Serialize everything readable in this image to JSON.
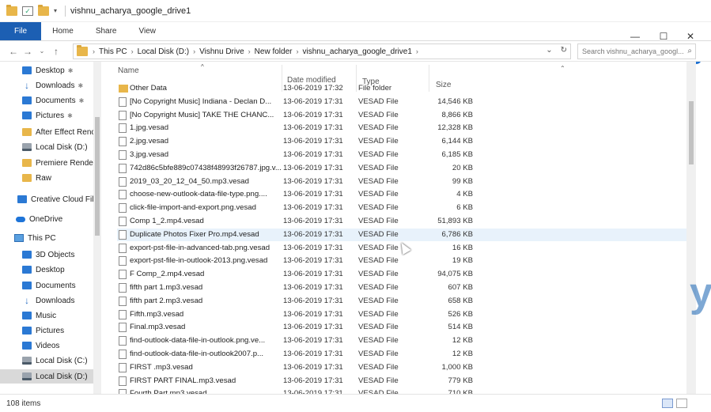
{
  "window": {
    "title": "vishnu_acharya_google_drive1",
    "minimize": "—",
    "maximize": "☐",
    "close": "✕"
  },
  "ribbon": {
    "tabs": [
      "File",
      "Home",
      "Share",
      "View"
    ]
  },
  "address": {
    "crumbs": [
      "This PC",
      "Local Disk (D:)",
      "Vishnu Drive",
      "New folder",
      "vishnu_acharya_google_drive1"
    ],
    "search_placeholder": "Search vishnu_acharya_googl..."
  },
  "nav": {
    "items": [
      {
        "label": "Desktop",
        "icon": "desktop-icon",
        "pinned": true
      },
      {
        "label": "Downloads",
        "icon": "download-arrow-icon",
        "pinned": true
      },
      {
        "label": "Documents",
        "icon": "documents-icon",
        "pinned": true
      },
      {
        "label": "Pictures",
        "icon": "pictures-icon",
        "pinned": true
      },
      {
        "label": "After Effect Renc",
        "icon": "folder-icon",
        "pinned": false
      },
      {
        "label": "Local Disk (D:)",
        "icon": "drive-icon",
        "pinned": false
      },
      {
        "label": "Premiere Render",
        "icon": "folder-icon",
        "pinned": false
      },
      {
        "label": "Raw",
        "icon": "folder-icon",
        "pinned": false
      },
      {
        "label": "Creative Cloud Fil",
        "icon": "creative-cloud-icon",
        "pinned": false
      },
      {
        "label": "OneDrive",
        "icon": "onedrive-icon",
        "pinned": false
      },
      {
        "label": "This PC",
        "icon": "this-pc-icon",
        "pinned": false
      },
      {
        "label": "3D Objects",
        "icon": "3d-objects-icon",
        "pinned": false
      },
      {
        "label": "Desktop",
        "icon": "desktop-icon",
        "pinned": false
      },
      {
        "label": "Documents",
        "icon": "documents-icon",
        "pinned": false
      },
      {
        "label": "Downloads",
        "icon": "download-arrow-icon",
        "pinned": false
      },
      {
        "label": "Music",
        "icon": "music-icon",
        "pinned": false
      },
      {
        "label": "Pictures",
        "icon": "pictures-icon",
        "pinned": false
      },
      {
        "label": "Videos",
        "icon": "videos-icon",
        "pinned": false
      },
      {
        "label": "Local Disk (C:)",
        "icon": "drive-icon",
        "pinned": false
      },
      {
        "label": "Local Disk (D:)",
        "icon": "drive-icon",
        "pinned": false,
        "selected": true
      }
    ]
  },
  "columns": {
    "name": "Name",
    "date": "Date modified",
    "type": "Type",
    "size": "Size"
  },
  "files": [
    {
      "name": "Other Data",
      "date": "13-06-2019 17:32",
      "type": "File folder",
      "size": "",
      "folder": true
    },
    {
      "name": "[No Copyright Music] Indiana - Declan D...",
      "date": "13-06-2019 17:31",
      "type": "VESAD File",
      "size": "14,546 KB"
    },
    {
      "name": "[No Copyright Music] TAKE THE CHANC...",
      "date": "13-06-2019 17:31",
      "type": "VESAD File",
      "size": "8,866 KB"
    },
    {
      "name": "1.jpg.vesad",
      "date": "13-06-2019 17:31",
      "type": "VESAD File",
      "size": "12,328 KB"
    },
    {
      "name": "2.jpg.vesad",
      "date": "13-06-2019 17:31",
      "type": "VESAD File",
      "size": "6,144 KB"
    },
    {
      "name": "3.jpg.vesad",
      "date": "13-06-2019 17:31",
      "type": "VESAD File",
      "size": "6,185 KB"
    },
    {
      "name": "742d86c5bfe889c07438f48993f26787.jpg.v...",
      "date": "13-06-2019 17:31",
      "type": "VESAD File",
      "size": "20 KB"
    },
    {
      "name": "2019_03_20_12_04_50.mp3.vesad",
      "date": "13-06-2019 17:31",
      "type": "VESAD File",
      "size": "99 KB"
    },
    {
      "name": "choose-new-outlook-data-file-type.png....",
      "date": "13-06-2019 17:31",
      "type": "VESAD File",
      "size": "4 KB"
    },
    {
      "name": "click-file-import-and-export.png.vesad",
      "date": "13-06-2019 17:31",
      "type": "VESAD File",
      "size": "6 KB"
    },
    {
      "name": "Comp 1_2.mp4.vesad",
      "date": "13-06-2019 17:31",
      "type": "VESAD File",
      "size": "51,893 KB"
    },
    {
      "name": "Duplicate Photos Fixer Pro.mp4.vesad",
      "date": "13-06-2019 17:31",
      "type": "VESAD File",
      "size": "6,786 KB",
      "hover": true
    },
    {
      "name": "export-pst-file-in-advanced-tab.png.vesad",
      "date": "13-06-2019 17:31",
      "type": "VESAD File",
      "size": "16 KB"
    },
    {
      "name": "export-pst-file-in-outlook-2013.png.vesad",
      "date": "13-06-2019 17:31",
      "type": "VESAD File",
      "size": "19 KB"
    },
    {
      "name": "F Comp_2.mp4.vesad",
      "date": "13-06-2019 17:31",
      "type": "VESAD File",
      "size": "94,075 KB"
    },
    {
      "name": "fifth part 1.mp3.vesad",
      "date": "13-06-2019 17:31",
      "type": "VESAD File",
      "size": "607 KB"
    },
    {
      "name": "fifth part 2.mp3.vesad",
      "date": "13-06-2019 17:31",
      "type": "VESAD File",
      "size": "658 KB"
    },
    {
      "name": "Fifth.mp3.vesad",
      "date": "13-06-2019 17:31",
      "type": "VESAD File",
      "size": "526 KB"
    },
    {
      "name": "Final.mp3.vesad",
      "date": "13-06-2019 17:31",
      "type": "VESAD File",
      "size": "514 KB"
    },
    {
      "name": "find-outlook-data-file-in-outlook.png.ve...",
      "date": "13-06-2019 17:31",
      "type": "VESAD File",
      "size": "12 KB"
    },
    {
      "name": "find-outlook-data-file-in-outlook2007.p...",
      "date": "13-06-2019 17:31",
      "type": "VESAD File",
      "size": "12 KB"
    },
    {
      "name": "FIRST .mp3.vesad",
      "date": "13-06-2019 17:31",
      "type": "VESAD File",
      "size": "1,000 KB"
    },
    {
      "name": "FIRST PART FINAL.mp3.vesad",
      "date": "13-06-2019 17:31",
      "type": "VESAD File",
      "size": "779 KB"
    },
    {
      "name": "Fourth Part.mp3.vesad",
      "date": "13-06-2019 17:31",
      "type": "VESAD File",
      "size": "710 KB"
    }
  ],
  "status": {
    "items_count": "108 items"
  },
  "colors": {
    "accent": "#1c5fb3",
    "folder": "#e8b64a"
  }
}
